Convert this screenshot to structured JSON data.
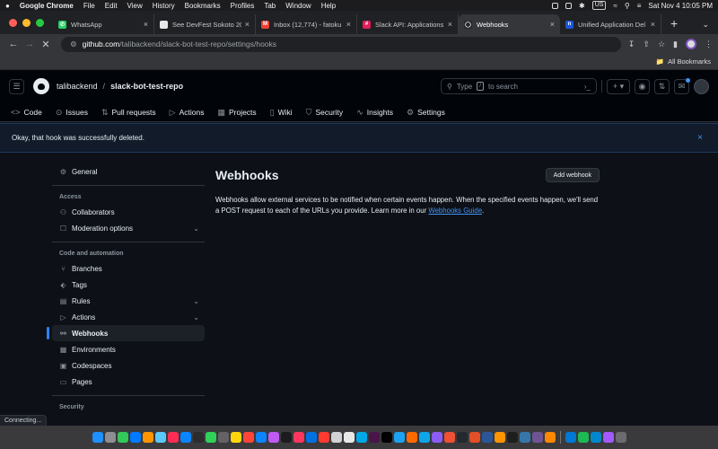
{
  "menubar": {
    "app": "Google Chrome",
    "items": [
      "File",
      "Edit",
      "View",
      "History",
      "Bookmarks",
      "Profiles",
      "Tab",
      "Window",
      "Help"
    ],
    "input_badge": "US",
    "datetime": "Sat Nov 4  10:05 PM"
  },
  "tabs": [
    {
      "title": "WhatsApp",
      "icon": "whatsapp-icon",
      "color": "#25d366",
      "glyph": "✆"
    },
    {
      "title": "See DevFest Sokoto 20",
      "icon": "page-icon",
      "color": "#e8e8e8",
      "glyph": ""
    },
    {
      "title": "Inbox (12,774) - fatoku",
      "icon": "gmail-icon",
      "color": "#ea4335",
      "glyph": "M"
    },
    {
      "title": "Slack API: Applications",
      "icon": "slack-icon",
      "color": "#e01e5a",
      "glyph": "#"
    },
    {
      "title": "Webhooks",
      "icon": "github-icon",
      "color": "#24292f",
      "glyph": "◯"
    },
    {
      "title": "Unified Application Del",
      "icon": "n-icon",
      "color": "#1a56db",
      "glyph": "n"
    }
  ],
  "address": {
    "host": "github.com",
    "path": "/talibackend/slack-bot-test-repo/settings/hooks"
  },
  "bookmarks": {
    "label": "All Bookmarks"
  },
  "repo": {
    "owner": "talibackend",
    "separator": "/",
    "name": "slack-bot-test-repo"
  },
  "search": {
    "placeholder_before": "Type",
    "key": "/",
    "placeholder_after": "to search"
  },
  "repo_nav": [
    {
      "label": "Code",
      "icon": "code-icon",
      "glyph": "<>"
    },
    {
      "label": "Issues",
      "icon": "issue-icon",
      "glyph": "⊙"
    },
    {
      "label": "Pull requests",
      "icon": "pull-request-icon",
      "glyph": "⇅"
    },
    {
      "label": "Actions",
      "icon": "play-icon",
      "glyph": "▷"
    },
    {
      "label": "Projects",
      "icon": "table-icon",
      "glyph": "▦"
    },
    {
      "label": "Wiki",
      "icon": "book-icon",
      "glyph": "▯"
    },
    {
      "label": "Security",
      "icon": "shield-icon",
      "glyph": "⛉"
    },
    {
      "label": "Insights",
      "icon": "graph-icon",
      "glyph": "∿"
    },
    {
      "label": "Settings",
      "icon": "gear-icon",
      "glyph": "⚙"
    }
  ],
  "flash": {
    "message": "Okay, that hook was successfully deleted.",
    "close": "×"
  },
  "sidebar": {
    "general": {
      "label": "General",
      "glyph": "⚙"
    },
    "access_heading": "Access",
    "access": [
      {
        "label": "Collaborators",
        "glyph": "⚇"
      },
      {
        "label": "Moderation options",
        "glyph": "☐",
        "chevron": true
      }
    ],
    "code_heading": "Code and automation",
    "code": [
      {
        "label": "Branches",
        "glyph": "⑂"
      },
      {
        "label": "Tags",
        "glyph": "⬖"
      },
      {
        "label": "Rules",
        "glyph": "▤",
        "chevron": true
      },
      {
        "label": "Actions",
        "glyph": "▷",
        "chevron": true
      },
      {
        "label": "Webhooks",
        "glyph": "⚯",
        "active": true
      },
      {
        "label": "Environments",
        "glyph": "▦"
      },
      {
        "label": "Codespaces",
        "glyph": "▣"
      },
      {
        "label": "Pages",
        "glyph": "▭"
      }
    ],
    "security_heading": "Security"
  },
  "main": {
    "title": "Webhooks",
    "add_button": "Add webhook",
    "description": "Webhooks allow external services to be notified when certain events happen. When the specified events happen, we'll send a POST request to each of the URLs you provide. Learn more in our",
    "link": "Webhooks Guide",
    "period": "."
  },
  "status": "Connecting...",
  "dock_colors": [
    "#1e90ff",
    "#8e8e93",
    "#34c759",
    "#007aff",
    "#ff9500",
    "#5ac8fa",
    "#ff2d55",
    "#0a84ff",
    "#2c2c2e",
    "#30d158",
    "#636366",
    "#ffd60a",
    "#ff453a",
    "#0a84ff",
    "#bf5af2",
    "#1c1c1e",
    "#ff375f",
    "#0071e3",
    "#ff3b30",
    "#d1d1d6",
    "#e8e8e8",
    "#00a8e8",
    "#4a154b",
    "#000000",
    "#1da1f2",
    "#ff6a00",
    "#0ea5e9",
    "#8b5cf6",
    "#f05033",
    "#24292f",
    "#e34f26",
    "#2b579a",
    "#ff9500",
    "#1e1e1e",
    "#3776ab",
    "#6e5494",
    "#ff8800",
    "#0078d4",
    "#1db954",
    "#0088cc",
    "#a259ff",
    "#6c6c70"
  ]
}
